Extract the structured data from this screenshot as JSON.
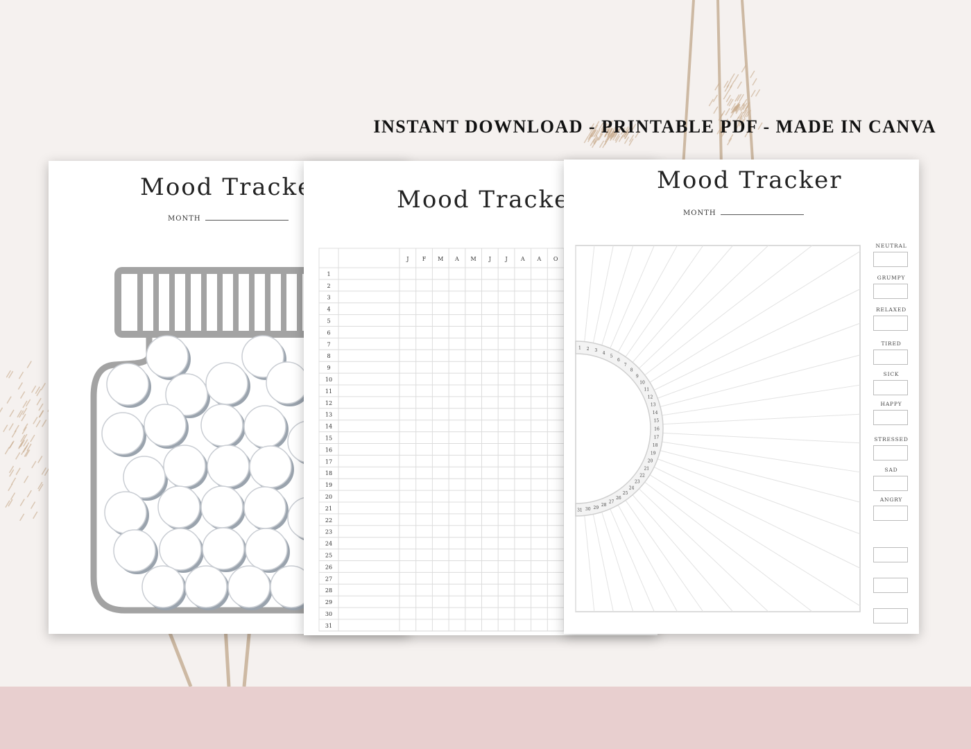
{
  "headline": "INSTANT DOWNLOAD - PRINTABLE PDF - MADE IN CANVA",
  "colors": {
    "background": "#f5f1ef",
    "banner": "#e8cfcf",
    "jar": "#a3a3a3",
    "grid": "#dcdcdc"
  },
  "sheets": [
    {
      "title": "Mood Tracker",
      "month_label": "MONTH"
    },
    {
      "title": "Mood Tracker",
      "month_headers": [
        "J",
        "F",
        "M",
        "A",
        "M",
        "J",
        "J",
        "A",
        "A",
        "O"
      ],
      "day_numbers": [
        "1",
        "2",
        "3",
        "4",
        "5",
        "6",
        "7",
        "8",
        "9",
        "10",
        "11",
        "12",
        "13",
        "14",
        "15",
        "16",
        "17",
        "18",
        "19",
        "20",
        "21",
        "22",
        "23",
        "24",
        "25",
        "26",
        "27",
        "28",
        "29",
        "30",
        "31"
      ]
    },
    {
      "title": "Mood Tracker",
      "month_label": "MONTH",
      "moods": [
        "NEUTRAL",
        "GRUMPY",
        "RELAXED",
        "TIRED",
        "SICK",
        "HAPPY",
        "STRESSED",
        "SAD",
        "ANGRY",
        "",
        "",
        ""
      ]
    }
  ]
}
